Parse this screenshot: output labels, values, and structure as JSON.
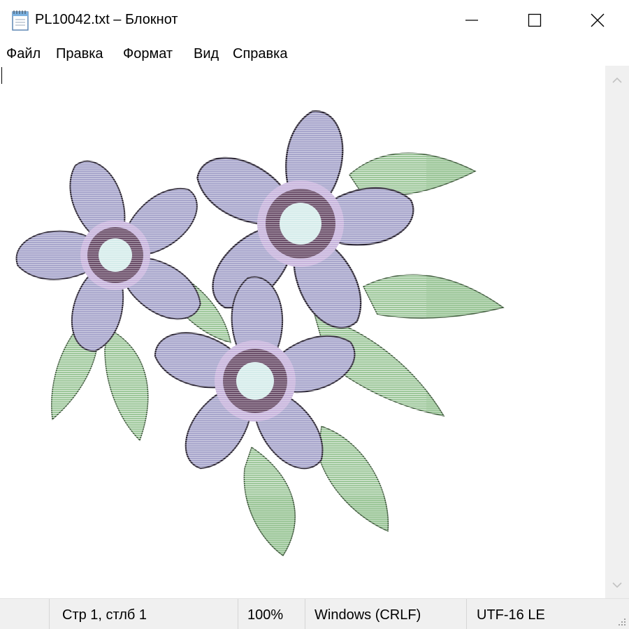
{
  "window": {
    "title": "PL10042.txt – Блокнот",
    "controls": {
      "minimize": "minimize",
      "maximize": "maximize",
      "close": "close"
    }
  },
  "menu": {
    "items": [
      "Файл",
      "Правка",
      "Формат",
      "Вид",
      "Справка"
    ]
  },
  "editor": {
    "content_description": "ASCII art of purple flowers with green leaves",
    "colors": {
      "petal": "#a8a6cc",
      "petal_edge": "#2a2433",
      "center_ring": "#6b4f6a",
      "center_light": "#c7b4dc",
      "center": "#d6eceb",
      "leaf": "#9dc79a",
      "leaf_edge": "#3d5a3a"
    }
  },
  "scrollbar": {
    "up_icon": "chevron-up-icon",
    "down_icon": "chevron-down-icon"
  },
  "status": {
    "position": "Стр 1, стлб 1",
    "zoom": "100%",
    "line_endings": "Windows (CRLF)",
    "encoding": "UTF-16 LE"
  }
}
